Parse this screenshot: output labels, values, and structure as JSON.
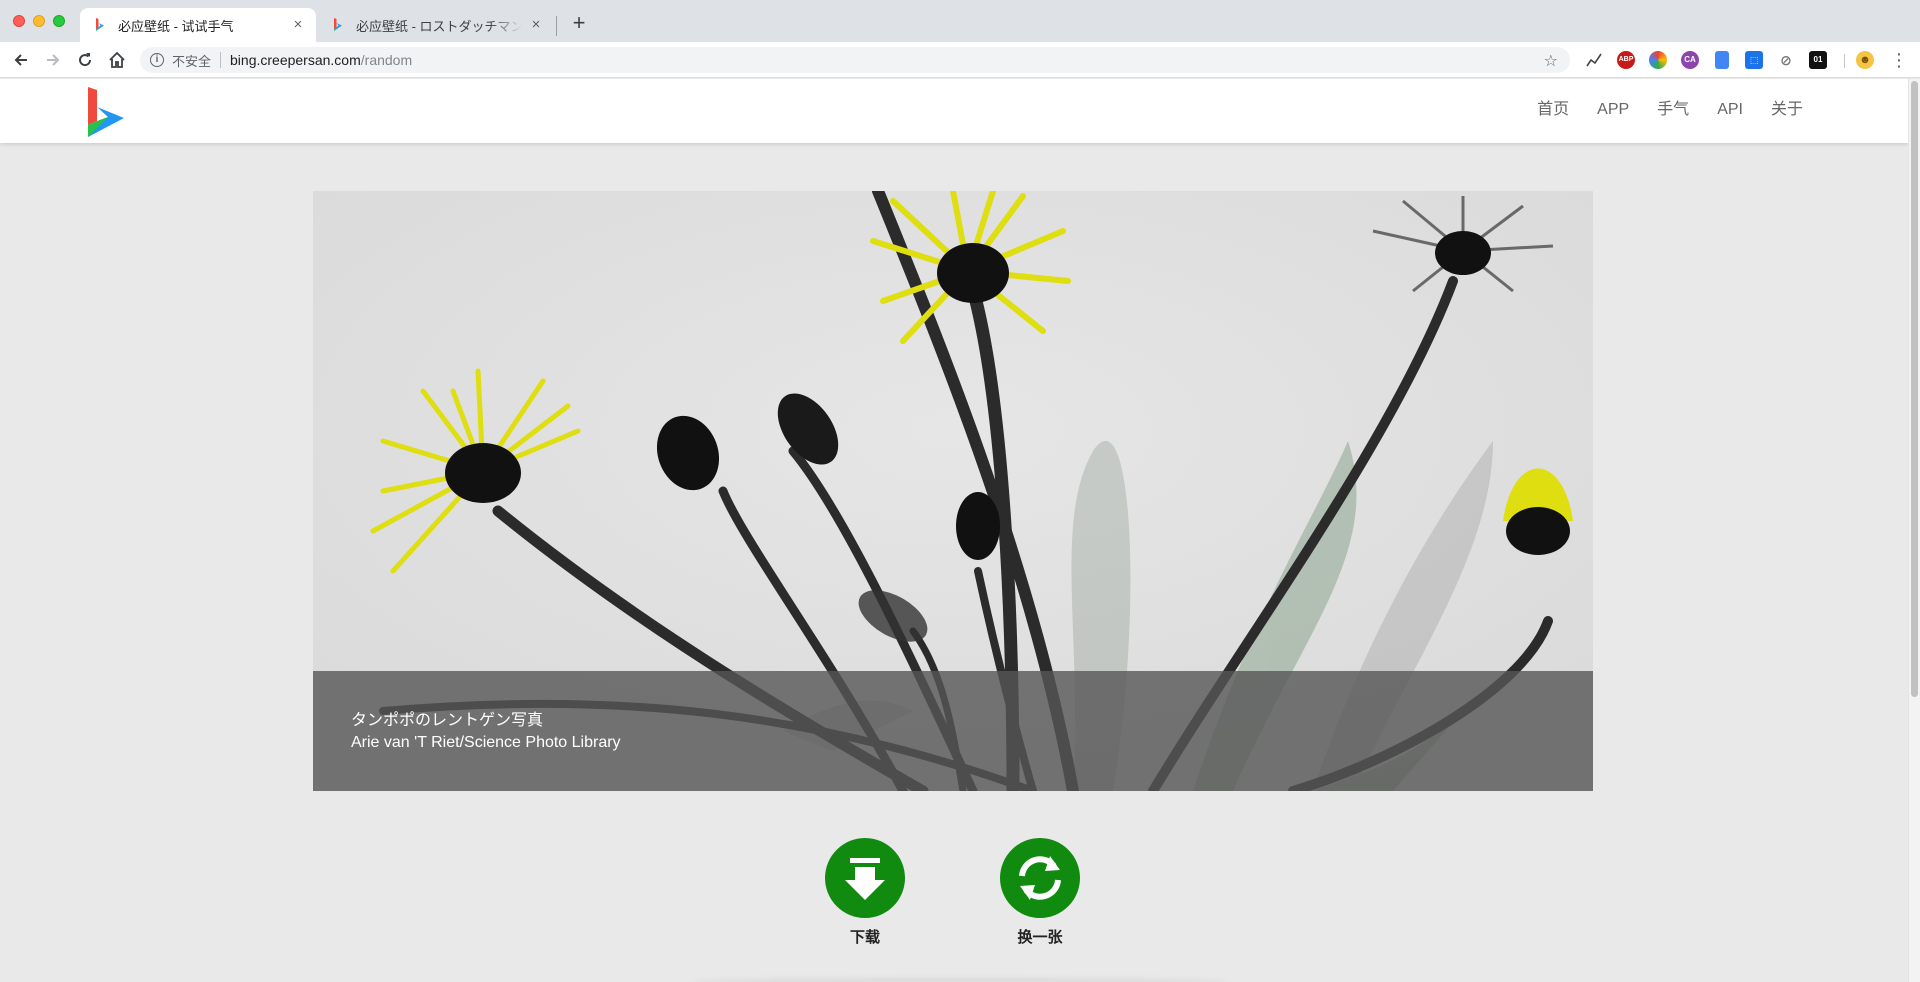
{
  "browser": {
    "tabs": [
      {
        "title": "必应壁纸 - 试试手气",
        "active": true,
        "close": "×"
      },
      {
        "title": "必应壁纸 - ロストダッチマン州立公園",
        "active": false,
        "close": "×"
      }
    ],
    "new_tab": "+",
    "security_label": "不安全",
    "url_host": "bing.creepersan.com",
    "url_path": "/random",
    "extension_icons": [
      "chart-icon",
      "abp-icon",
      "color-wheel-icon",
      "ca-icon",
      "docs-icon",
      "dropbox-icon",
      "block-icon",
      "binary-icon",
      "avatar-icon"
    ]
  },
  "site": {
    "nav": [
      "首页",
      "APP",
      "手气",
      "API",
      "关于"
    ],
    "photo": {
      "title": "タンポポのレントゲン写真",
      "copyright": "Arie van 'T Riet/Science Photo Library"
    },
    "actions": {
      "download": "下载",
      "refresh": "换一张"
    },
    "colors": {
      "accent_green": "#108b10",
      "header_bg": "#ffffff",
      "page_bg": "#e9e9e9",
      "flower_yellow": "#e2e21a"
    }
  }
}
